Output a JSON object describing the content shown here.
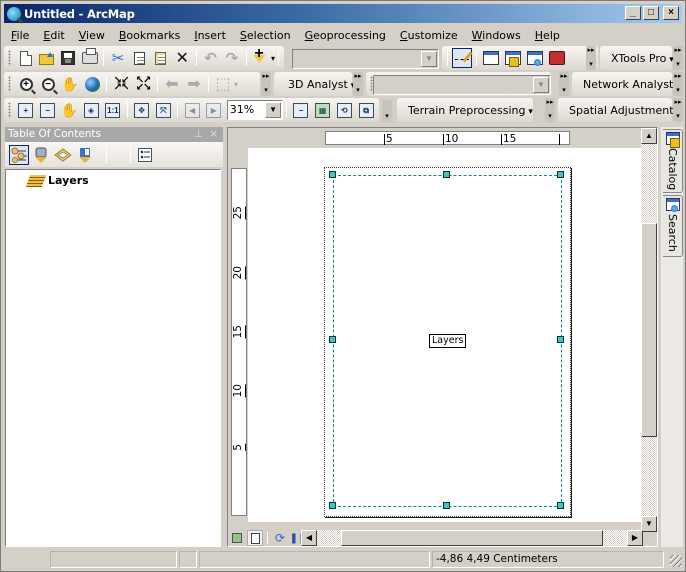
{
  "window": {
    "title": "Untitled - ArcMap",
    "controls": [
      "_",
      "□",
      "×"
    ]
  },
  "menubar": [
    {
      "label": "File",
      "u": "F"
    },
    {
      "label": "Edit",
      "u": "E"
    },
    {
      "label": "View",
      "u": "V"
    },
    {
      "label": "Bookmarks",
      "u": "B"
    },
    {
      "label": "Insert",
      "u": "I"
    },
    {
      "label": "Selection",
      "u": "S"
    },
    {
      "label": "Geoprocessing",
      "u": "G"
    },
    {
      "label": "Customize",
      "u": "C"
    },
    {
      "label": "Windows",
      "u": "W"
    },
    {
      "label": "Help",
      "u": "H"
    }
  ],
  "toolbars": {
    "standard": [
      "new-document",
      "open",
      "save",
      "print",
      "cut",
      "copy",
      "paste",
      "delete",
      "undo",
      "redo",
      "add-data"
    ],
    "scale_combo_value": "",
    "editor_tools": [
      "editor-toolbar",
      "table-of-contents",
      "catalog-window",
      "search-window",
      "arctoolbox"
    ],
    "xtools_label": "XTools Pro",
    "tools": [
      "zoom-in",
      "zoom-out",
      "pan",
      "full-extent",
      "fixed-zoom-in",
      "fixed-zoom-out",
      "back-extent",
      "forward-extent",
      "select-features"
    ],
    "analyst3d_label": "3D Analyst",
    "analyst3d_combo_value": "",
    "network_label": "Network Analyst",
    "layout": [
      "layout-zoom-in",
      "layout-zoom-out",
      "layout-pan",
      "zoom-whole-page",
      "zoom-100",
      "fixed-zoom-in",
      "fixed-zoom-out",
      "previous-extent",
      "next-extent"
    ],
    "zoom_percent": "31%",
    "layout_extra": [
      "toggle-draft-mode",
      "focus-data-frame",
      "change-layout",
      "data-driven-pages"
    ],
    "terrain_label": "Terrain Preprocessing",
    "spatial_adj_label": "Spatial Adjustment"
  },
  "toc": {
    "title": "Table Of Contents",
    "pin": "ᵖ",
    "close": "×",
    "tools": [
      "list-by-drawing-order",
      "list-by-source",
      "list-by-visibility",
      "list-by-selection",
      "options"
    ],
    "layers_label": "Layers"
  },
  "layout_view": {
    "hruler_ticks": [
      "5",
      "10",
      "15"
    ],
    "vruler_ticks": [
      "25",
      "20",
      "15",
      "10",
      "5"
    ],
    "data_frame_label": "Layers",
    "view_buttons": [
      "data-view",
      "layout-view",
      "refresh",
      "pause-drawing"
    ]
  },
  "dock": {
    "tabs": [
      {
        "label": "Catalog"
      },
      {
        "label": "Search"
      }
    ]
  },
  "status": {
    "coordinates": "-4,86  4,49 Centimeters"
  }
}
